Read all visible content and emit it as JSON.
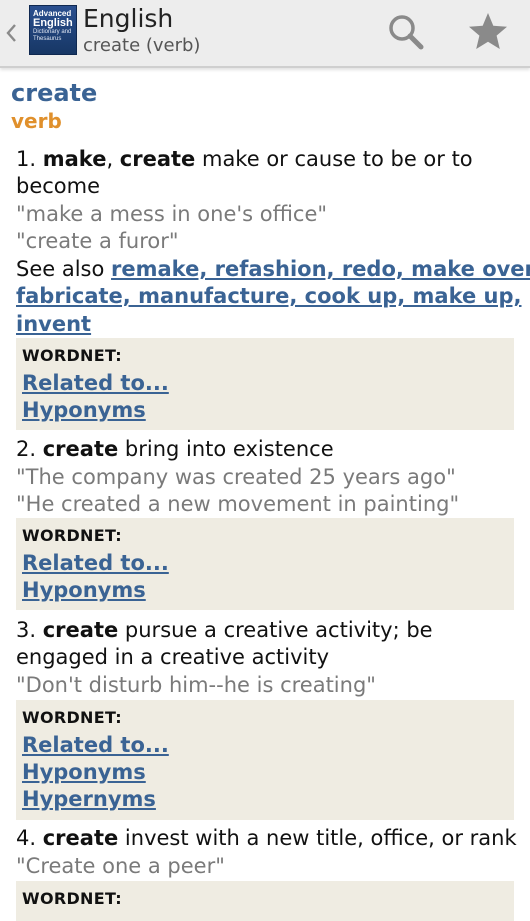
{
  "header": {
    "back_icon": "chevron-left-icon",
    "logo": {
      "line1": "Advanced",
      "line2": "English",
      "line3": "Dictionary and",
      "line4": "Thesaurus"
    },
    "title": "English",
    "subtitle": "create (verb)",
    "search_icon": "search-icon",
    "favorite_icon": "star-icon"
  },
  "entry": {
    "headword": "create",
    "pos": "verb",
    "senses": [
      {
        "number": "1.",
        "words": [
          "make",
          "create"
        ],
        "definition": "make or cause to be or to become",
        "examples": [
          "\"make a mess in one's office\"",
          "\"create a furor\""
        ],
        "see_also_label": "See also",
        "see_also": [
          "remake, refashion, redo, make over",
          "fabricate, manufacture, cook up, make up,",
          "invent"
        ],
        "wordnet_label": "WORDNET:",
        "wordnet_links": [
          "Related to...",
          "Hyponyms"
        ]
      },
      {
        "number": "2.",
        "words": [
          "create"
        ],
        "definition": "bring into existence",
        "examples": [
          "\"The company was created 25 years ago\"",
          "\"He created a new movement in painting\""
        ],
        "wordnet_label": "WORDNET:",
        "wordnet_links": [
          "Related to...",
          "Hyponyms"
        ]
      },
      {
        "number": "3.",
        "words": [
          "create"
        ],
        "definition": "pursue a creative activity; be engaged in a creative activity",
        "examples": [
          "\"Don't disturb him--he is creating\""
        ],
        "wordnet_label": "WORDNET:",
        "wordnet_links": [
          "Related to...",
          "Hyponyms",
          "Hypernyms"
        ]
      },
      {
        "number": "4.",
        "words": [
          "create"
        ],
        "definition": "invest with a new title, office, or rank",
        "examples": [
          "\"Create one a peer\""
        ],
        "wordnet_label": "WORDNET:"
      }
    ]
  },
  "colors": {
    "link": "#3a6394",
    "pos": "#e0902c",
    "example": "#7a7a7a",
    "wordnet_bg": "#efece2",
    "actionbar_bg": "#ededed"
  }
}
